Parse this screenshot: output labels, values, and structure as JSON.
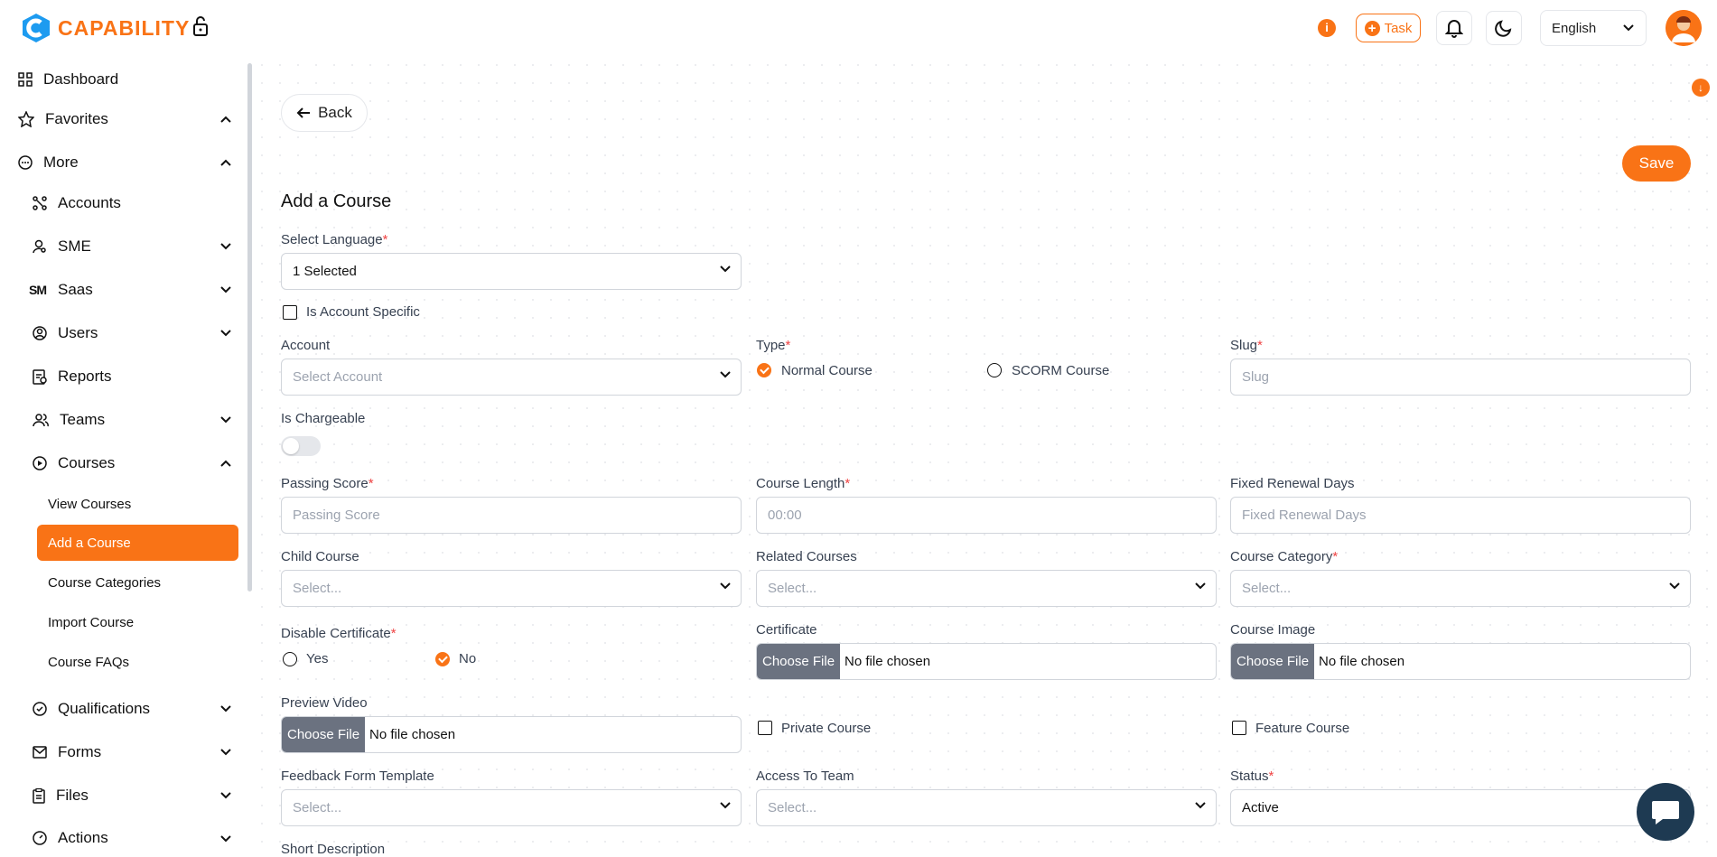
{
  "app": {
    "logo_text": "CAPABILITY",
    "accent": "#f97316"
  },
  "topbar": {
    "info_label": "i",
    "task_label": "Task",
    "language": "English"
  },
  "sidebar": {
    "dashboard": "Dashboard",
    "favorites": "Favorites",
    "more": "More",
    "accounts": "Accounts",
    "sme": "SME",
    "saas": "Saas",
    "users": "Users",
    "reports": "Reports",
    "teams": "Teams",
    "courses": "Courses",
    "course_items": [
      "View Courses",
      "Add a Course",
      "Course Categories",
      "Import Course",
      "Course FAQs"
    ],
    "qualifications": "Qualifications",
    "forms": "Forms",
    "files": "Files",
    "actions": "Actions"
  },
  "main": {
    "back": "Back",
    "save": "Save",
    "title": "Add a Course",
    "select_language": {
      "label": "Select Language",
      "value": "1 Selected"
    },
    "is_account_specific": "Is Account Specific",
    "account": {
      "label": "Account",
      "placeholder": "Select Account"
    },
    "type": {
      "label": "Type",
      "opt1": "Normal Course",
      "opt2": "SCORM Course"
    },
    "slug": {
      "label": "Slug",
      "placeholder": "Slug"
    },
    "is_chargeable": "Is Chargeable",
    "passing_score": {
      "label": "Passing Score",
      "placeholder": "Passing Score"
    },
    "course_length": {
      "label": "Course Length",
      "placeholder": "00:00"
    },
    "fixed_renewal": {
      "label": "Fixed Renewal Days",
      "placeholder": "Fixed Renewal Days"
    },
    "child_course": {
      "label": "Child Course",
      "placeholder": "Select..."
    },
    "related_courses": {
      "label": "Related Courses",
      "placeholder": "Select..."
    },
    "course_category": {
      "label": "Course Category",
      "placeholder": "Select..."
    },
    "disable_certificate": {
      "label": "Disable Certificate",
      "yes": "Yes",
      "no": "No"
    },
    "certificate": {
      "label": "Certificate"
    },
    "course_image": {
      "label": "Course Image"
    },
    "choose_file": "Choose File",
    "no_file": "No file chosen",
    "preview_video": {
      "label": "Preview Video"
    },
    "private_course": "Private Course",
    "feature_course": "Feature Course",
    "feedback_form": {
      "label": "Feedback Form Template",
      "placeholder": "Select..."
    },
    "access_team": {
      "label": "Access To Team",
      "placeholder": "Select..."
    },
    "status": {
      "label": "Status",
      "value": "Active"
    },
    "short_description": "Short Description",
    "required_mark": "*"
  }
}
